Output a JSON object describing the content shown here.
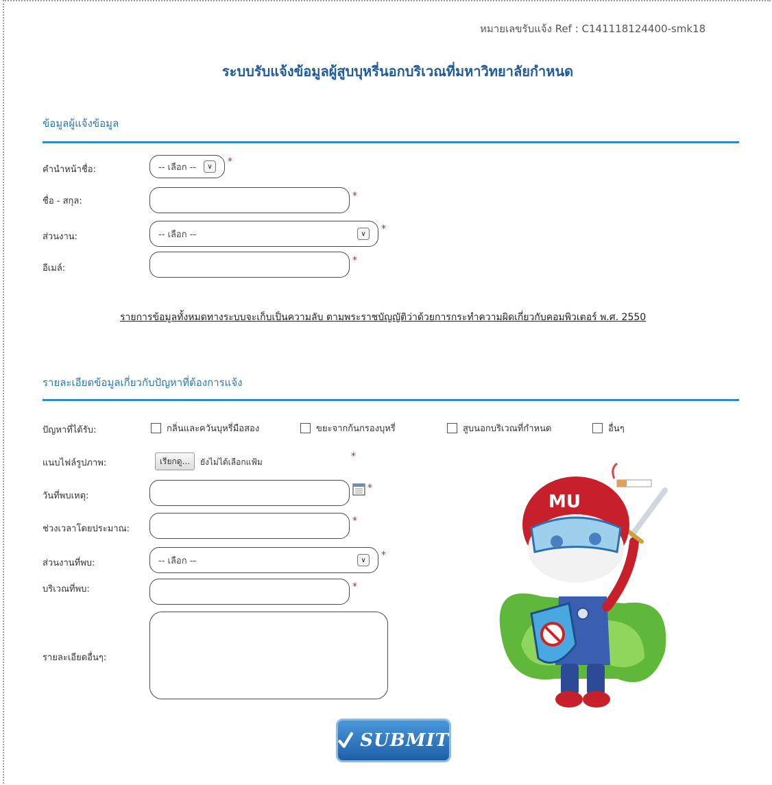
{
  "header": {
    "ref_text": "หมายเลขรับแจ้ง Ref : C141118124400-smk18",
    "title": "ระบบรับแจ้งข้อมูลผู้สูบบุหรี่นอกบริเวณที่มหาวิทยาลัยกำหนด"
  },
  "reporter_section": {
    "heading": "ข้อมูลผู้แจ้งข้อมูล",
    "title_label": "คำนำหน้าชื่อ:",
    "title_select": "-- เลือก --",
    "name_label": "ชื่อ - สกุล:",
    "name_value": "",
    "department_label": "ส่วนงาน:",
    "department_select": "-- เลือก --",
    "email_label": "อีเมล์:",
    "email_value": "",
    "required_mark": "*"
  },
  "disclaimer": "รายการข้อมูลทั้งหมดทางระบบจะเก็บเป็นความลับ ตามพระราชบัญญัติว่าด้วยการกระทำความผิดเกี่ยวกับคอมพิวเตอร์ พ.ศ. 2550",
  "problem_section": {
    "heading": "รายละเอียดข้อมูลเกี่ยวกับปัญหาที่ต้องการแจ้ง",
    "problem_label": "ปัญหาที่ได้รับ:",
    "options": [
      "กลิ่นและควันบุหรี่มือสอง",
      "ขยะจากก้นกรองบุหรี่",
      "สูบนอกบริเวณที่กำหนด",
      "อื่นๆ"
    ],
    "photo_label": "แนบไฟล์รูปภาพ:",
    "browse_label": "เรียกดู...",
    "no_file_text": "ยังไม่ได้เลือกแฟ้ม",
    "date_label": "วันที่พบเหตุ:",
    "time_label": "ช่วงเวลาโดยประมาณ:",
    "found_department_label": "ส่วนงานที่พบ:",
    "found_department_select": "-- เลือก --",
    "location_label": "บริเวณที่พบ:",
    "details_label": "รายละเอียดอื่นๆ:"
  },
  "submit": {
    "label": "SUBMIT"
  },
  "hero": {
    "helmet_text": "MU"
  },
  "colors": {
    "accent": "#2e8bc8",
    "title": "#1f5b9c",
    "required": "#d42020"
  }
}
